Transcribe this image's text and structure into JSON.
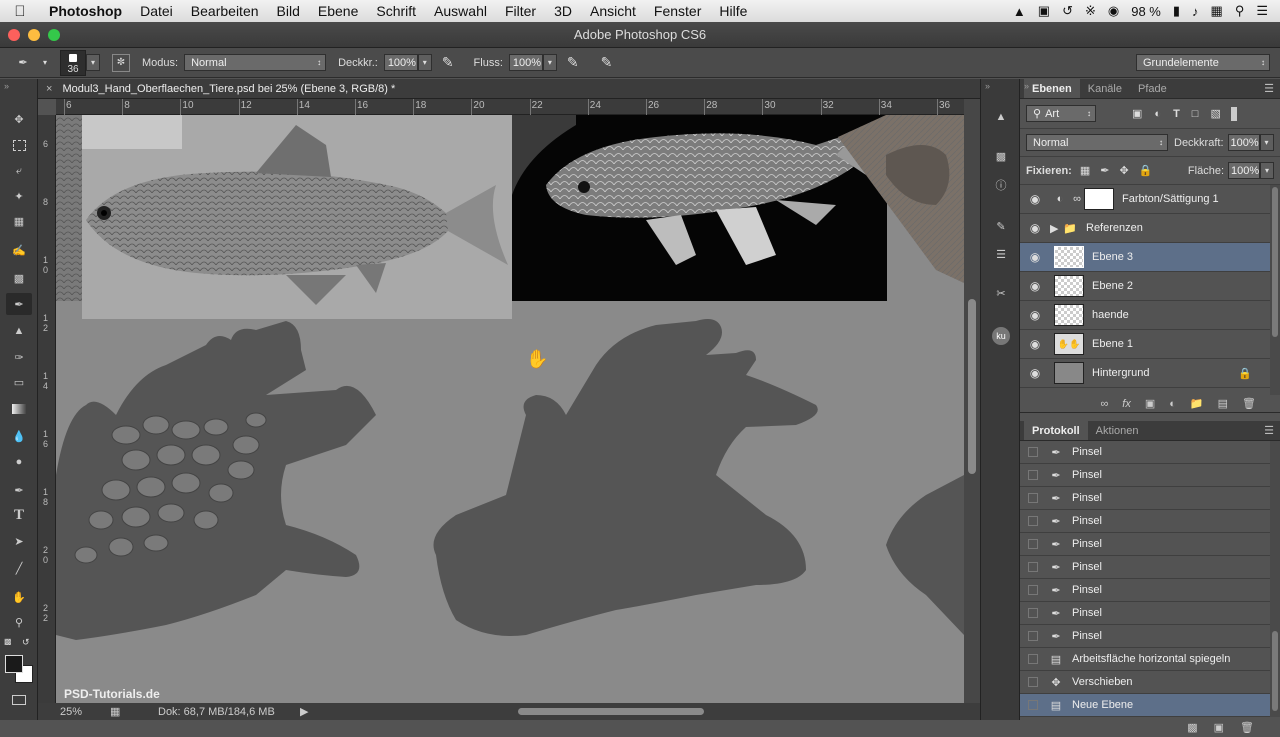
{
  "menubar": {
    "apple": "",
    "app": "Photoshop",
    "menus": [
      "Datei",
      "Bearbeiten",
      "Bild",
      "Ebene",
      "Schrift",
      "Auswahl",
      "Filter",
      "3D",
      "Ansicht",
      "Fenster",
      "Hilfe"
    ],
    "battery": "98 %"
  },
  "window": {
    "title": "Adobe Photoshop CS6"
  },
  "options": {
    "brush_size": "36",
    "modus_label": "Modus:",
    "modus_value": "Normal",
    "deckkr_label": "Deckkr.:",
    "deckkr_value": "100%",
    "fluss_label": "Fluss:",
    "fluss_value": "100%",
    "workspace": "Grundelemente"
  },
  "document": {
    "tab_title": "Modul3_Hand_Oberflaechen_Tiere.psd bei 25% (Ebene 3, RGB/8) *",
    "ruler_top": [
      "6",
      "8",
      "10",
      "12",
      "14",
      "16",
      "18",
      "20",
      "22",
      "24",
      "26",
      "28",
      "30",
      "32",
      "34",
      "36"
    ],
    "ruler_left": [
      "6",
      "8",
      "1\n0",
      "1\n2",
      "1\n4",
      "1\n6",
      "1\n8",
      "2\n0",
      "2\n2"
    ]
  },
  "status": {
    "zoom": "25%",
    "doc_info": "Dok: 68,7 MB/184,6 MB",
    "watermark": "PSD-Tutorials.de"
  },
  "layers_panel": {
    "tabs": [
      "Ebenen",
      "Kanäle",
      "Pfade"
    ],
    "filter_label": "Art",
    "blend_mode": "Normal",
    "opacity_label": "Deckkraft:",
    "opacity_value": "100%",
    "lock_label": "Fixieren:",
    "fill_label": "Fläche:",
    "fill_value": "100%",
    "layers": [
      {
        "name": "Farbton/Sättigung 1",
        "kind": "adjustment",
        "selected": false
      },
      {
        "name": "Referenzen",
        "kind": "group",
        "selected": false
      },
      {
        "name": "Ebene 3",
        "kind": "transparent",
        "selected": true
      },
      {
        "name": "Ebene 2",
        "kind": "transparent",
        "selected": false
      },
      {
        "name": "haende",
        "kind": "transparent",
        "selected": false
      },
      {
        "name": "Ebene 1",
        "kind": "sketch",
        "selected": false
      },
      {
        "name": "Hintergrund",
        "kind": "background",
        "selected": false
      }
    ]
  },
  "history_panel": {
    "tabs": [
      "Protokoll",
      "Aktionen"
    ],
    "items": [
      {
        "label": "Pinsel",
        "icon": "brush-icon",
        "selected": false
      },
      {
        "label": "Pinsel",
        "icon": "brush-icon",
        "selected": false
      },
      {
        "label": "Pinsel",
        "icon": "brush-icon",
        "selected": false
      },
      {
        "label": "Pinsel",
        "icon": "brush-icon",
        "selected": false
      },
      {
        "label": "Pinsel",
        "icon": "brush-icon",
        "selected": false
      },
      {
        "label": "Pinsel",
        "icon": "brush-icon",
        "selected": false
      },
      {
        "label": "Pinsel",
        "icon": "brush-icon",
        "selected": false
      },
      {
        "label": "Pinsel",
        "icon": "brush-icon",
        "selected": false
      },
      {
        "label": "Pinsel",
        "icon": "brush-icon",
        "selected": false
      },
      {
        "label": "Arbeitsfläche horizontal spiegeln",
        "icon": "document-icon",
        "selected": false
      },
      {
        "label": "Verschieben",
        "icon": "move-icon",
        "selected": false
      },
      {
        "label": "Neue Ebene",
        "icon": "document-icon",
        "selected": true
      }
    ]
  },
  "colors": {
    "selection": "#5d6f89",
    "panel_bg": "#535353",
    "canvas_bg": "#8a8a8a"
  }
}
